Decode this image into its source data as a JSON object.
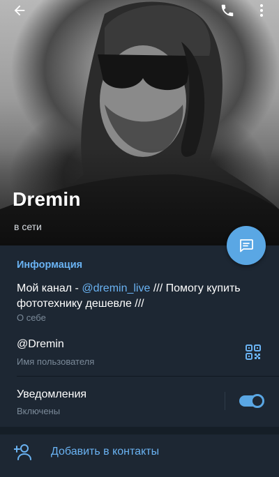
{
  "header": {
    "back_icon": "arrow-left-icon",
    "call_icon": "phone-icon",
    "more_icon": "more-vertical-icon"
  },
  "profile": {
    "name": "Dremin",
    "status": "в сети"
  },
  "fab": {
    "icon": "message-icon"
  },
  "info": {
    "title": "Информация",
    "bio_prefix": "Мой канал - ",
    "bio_link": "@dremin_live",
    "bio_suffix": " /// Помогу купить фототехнику дешевле ///",
    "bio_label": "О себе",
    "username": "@Dremin",
    "username_label": "Имя пользователя",
    "qr_icon": "qr-code-icon",
    "notifications": "Уведомления",
    "notifications_state": "Включены",
    "notifications_on": true
  },
  "actions": {
    "add_contact": "Добавить в контакты",
    "add_contact_icon": "add-user-icon"
  },
  "colors": {
    "background": "#1d2733",
    "accent": "#6ab3f3",
    "fab": "#5aa7e4",
    "secondary_text": "#7b8a99"
  }
}
